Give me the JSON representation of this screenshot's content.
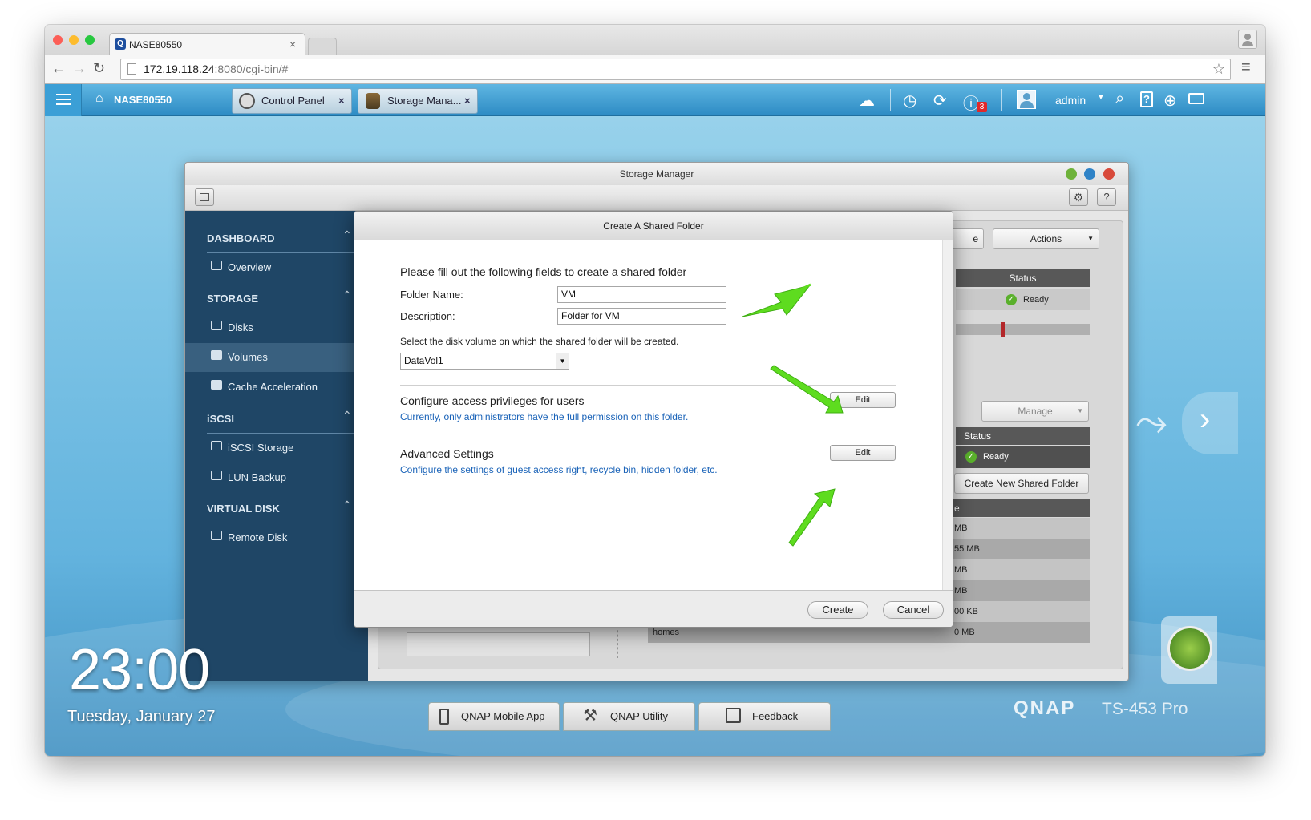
{
  "browser": {
    "tab_title": "NASE80550",
    "url_host": "172.19.118.24",
    "url_rest": ":8080/cgi-bin/#"
  },
  "qts": {
    "home_label": "NASE80550",
    "tabs": [
      {
        "label": "Control Panel"
      },
      {
        "label": "Storage Mana..."
      }
    ],
    "notification_count": "3",
    "user": "admin"
  },
  "storage_manager": {
    "title": "Storage Manager",
    "sidebar": {
      "sections": [
        {
          "label": "DASHBOARD",
          "items": [
            "Overview"
          ]
        },
        {
          "label": "STORAGE",
          "items": [
            "Disks",
            "Volumes",
            "Cache Acceleration"
          ]
        },
        {
          "label": "iSCSI",
          "items": [
            "iSCSI Storage",
            "LUN Backup"
          ]
        },
        {
          "label": "VIRTUAL DISK",
          "items": [
            "Remote Disk"
          ]
        }
      ],
      "active_item": "Volumes"
    },
    "background": {
      "partial_button": "e",
      "actions_label": "Actions",
      "status_header_1": "Status",
      "status_value_1": "Ready",
      "manage_label": "Manage",
      "status_header_2": "Status",
      "status_value_2": "Ready",
      "create_shared_folder_button": "Create New Shared Folder",
      "size_header": "e",
      "rows": [
        {
          "name": "",
          "size": "MB"
        },
        {
          "name": "",
          "size": "55 MB"
        },
        {
          "name": "",
          "size": "MB"
        },
        {
          "name": "",
          "size": "MB"
        },
        {
          "name": "",
          "size": "00 KB"
        },
        {
          "name": "homes",
          "size": "0 MB"
        }
      ]
    }
  },
  "dialog": {
    "title": "Create A Shared Folder",
    "intro": "Please fill out the following fields to create a shared folder",
    "folder_name_label": "Folder Name:",
    "folder_name_value": "VM",
    "description_label": "Description:",
    "description_value": "Folder for VM",
    "volume_prompt": "Select the disk volume on which the shared folder will be created.",
    "volume_value": "DataVol1",
    "access": {
      "heading": "Configure access privileges for users",
      "note": "Currently, only administrators have the full permission on this folder.",
      "edit_label": "Edit"
    },
    "advanced": {
      "heading": "Advanced Settings",
      "note": "Configure the settings of guest access right, recycle bin, hidden folder, etc.",
      "edit_label": "Edit"
    },
    "create_label": "Create",
    "cancel_label": "Cancel"
  },
  "desktop": {
    "clock": "23:00",
    "date": "Tuesday, January 27",
    "bottom_bar": [
      "QNAP Mobile App",
      "QNAP Utility",
      "Feedback"
    ],
    "brand": "QNAP",
    "model": "TS-453 Pro"
  },
  "colors": {
    "accent_arrow": "#5edc1f",
    "link_blue": "#1a63b8",
    "sidebar_bg": "#1f4666",
    "nav_blue": "#2d8bc4"
  }
}
